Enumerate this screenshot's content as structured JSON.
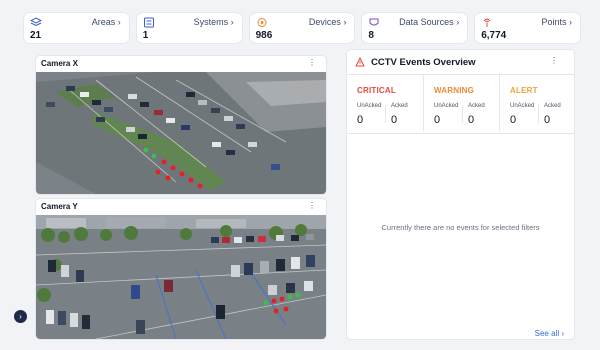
{
  "stats": [
    {
      "label": "Areas",
      "value": "21",
      "icon": "layers-icon"
    },
    {
      "label": "Systems",
      "value": "1",
      "icon": "server-icon"
    },
    {
      "label": "Devices",
      "value": "986",
      "icon": "device-icon"
    },
    {
      "label": "Data Sources",
      "value": "8",
      "icon": "data-source-icon"
    },
    {
      "label": "Points",
      "value": "6,774",
      "icon": "antenna-icon"
    }
  ],
  "arrow": "›",
  "cameras": [
    {
      "title": "Camera X",
      "menu": "⋮"
    },
    {
      "title": "Camera Y",
      "menu": "⋮"
    }
  ],
  "events": {
    "title": "CCTV Events Overview",
    "menu": "⋮",
    "severities": [
      {
        "name": "CRITICAL",
        "color": "#e5483d",
        "unacked_label": "UnAcked",
        "acked_label": "Acked",
        "unacked": "0",
        "acked": "0"
      },
      {
        "name": "WARNING",
        "color": "#ef8a34",
        "unacked_label": "UnAcked",
        "acked_label": "Acked",
        "unacked": "0",
        "acked": "0"
      },
      {
        "name": "ALERT",
        "color": "#f0a23a",
        "unacked_label": "UnAcked",
        "acked_label": "Acked",
        "unacked": "0",
        "acked": "0"
      }
    ],
    "empty_message": "Currently there are no events for selected filters",
    "see_all": "See all ›"
  },
  "collapse_icon": "›",
  "colors": {
    "accent": "#2f6fd6",
    "critical": "#e5483d",
    "warning": "#ef8a34",
    "alert": "#f0a23a",
    "collapse_bg": "#1e2a4a"
  }
}
